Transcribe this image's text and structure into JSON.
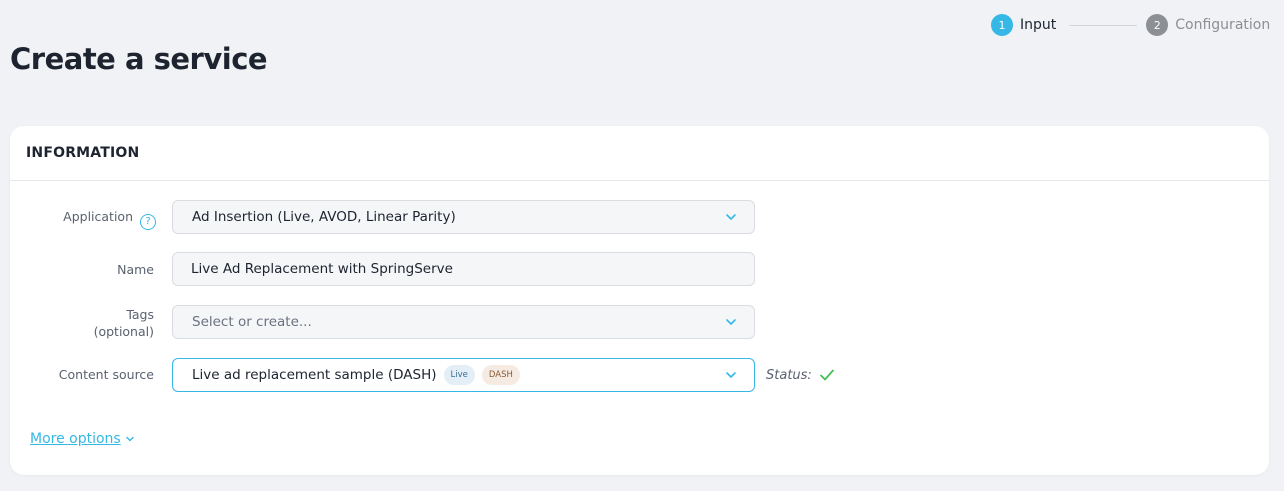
{
  "stepper": {
    "steps": [
      {
        "number": "1",
        "label": "Input",
        "state": "active"
      },
      {
        "number": "2",
        "label": "Configuration",
        "state": "inactive"
      }
    ]
  },
  "page": {
    "title": "Create a service"
  },
  "card": {
    "title": "INFORMATION"
  },
  "form": {
    "application": {
      "label": "Application",
      "help_icon": "question-icon",
      "value": "Ad Insertion (Live, AVOD, Linear Parity)"
    },
    "name": {
      "label": "Name",
      "value": "Live Ad Replacement with SpringServe"
    },
    "tags": {
      "label": "Tags",
      "sublabel": "(optional)",
      "placeholder": "Select or create..."
    },
    "content_source": {
      "label": "Content source",
      "value": "Live ad replacement sample (DASH)",
      "badges": [
        "Live",
        "DASH"
      ],
      "status_label": "Status:",
      "status_icon": "check-icon"
    }
  },
  "more_options": {
    "label": "More options"
  },
  "colors": {
    "accent": "#35b8e6",
    "status_ok": "#3fbf4f",
    "step_inactive": "#8c8f94"
  }
}
